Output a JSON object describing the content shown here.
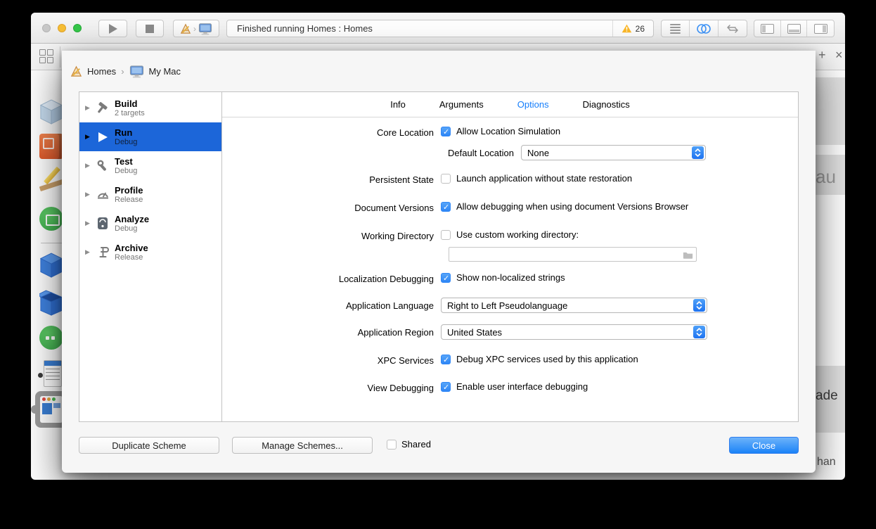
{
  "toolbar": {
    "status_text": "Finished running Homes : Homes",
    "warning_count": "26"
  },
  "window_chrome": {
    "tab_add": "+",
    "tab_close": "×"
  },
  "background": {
    "fragments": [
      "au",
      "ade",
      "han"
    ]
  },
  "sheet": {
    "breadcrumb": {
      "project": "Homes",
      "separator": "›",
      "destination": "My Mac"
    },
    "sidebar": {
      "items": [
        {
          "title": "Build",
          "subtitle": "2 targets",
          "selected": false
        },
        {
          "title": "Run",
          "subtitle": "Debug",
          "selected": true
        },
        {
          "title": "Test",
          "subtitle": "Debug",
          "selected": false
        },
        {
          "title": "Profile",
          "subtitle": "Release",
          "selected": false
        },
        {
          "title": "Analyze",
          "subtitle": "Debug",
          "selected": false
        },
        {
          "title": "Archive",
          "subtitle": "Release",
          "selected": false
        }
      ]
    },
    "tabs": [
      {
        "label": "Info",
        "selected": false
      },
      {
        "label": "Arguments",
        "selected": false
      },
      {
        "label": "Options",
        "selected": true
      },
      {
        "label": "Diagnostics",
        "selected": false
      }
    ],
    "form": {
      "rows": [
        {
          "label": "Core Location",
          "control": "checkbox",
          "checked": true,
          "text": "Allow Location Simulation"
        },
        {
          "label": "Default Location",
          "control": "popup",
          "value": "None"
        },
        {
          "label": "Persistent State",
          "control": "checkbox",
          "checked": false,
          "text": "Launch application without state restoration"
        },
        {
          "label": "Document Versions",
          "control": "checkbox",
          "checked": true,
          "text": "Allow debugging when using document Versions Browser"
        },
        {
          "label": "Working Directory",
          "control": "checkbox-field",
          "checked": false,
          "text": "Use custom working directory:",
          "field_value": ""
        },
        {
          "label": "Localization Debugging",
          "control": "checkbox",
          "checked": true,
          "text": "Show non-localized strings"
        },
        {
          "label": "Application Language",
          "control": "popup",
          "value": "Right to Left Pseudolanguage"
        },
        {
          "label": "Application Region",
          "control": "popup",
          "value": "United States"
        },
        {
          "label": "XPC Services",
          "control": "checkbox",
          "checked": true,
          "text": "Debug XPC services used by this application"
        },
        {
          "label": "View Debugging",
          "control": "checkbox",
          "checked": true,
          "text": "Enable user interface debugging"
        }
      ]
    },
    "footer": {
      "duplicate_label": "Duplicate Scheme",
      "manage_label": "Manage Schemes...",
      "shared_label": "Shared",
      "shared_checked": false,
      "close_label": "Close"
    }
  },
  "icons": {
    "play-icon": "▶",
    "stop-icon": "■",
    "xcode-scheme-icon": "A-frame-pencil",
    "my-mac-icon": "display-monitor",
    "warning-icon": "⚠",
    "standard-editor-icon": "text-lines",
    "assistant-editor-icon": "linked-circles",
    "version-editor-icon": "left-right-arrows",
    "navigator-panel-icon": "left-panel-rect",
    "debug-area-icon": "bottom-panel-rect",
    "inspector-panel-icon": "right-panel-rect",
    "disclosure-icon": "▶",
    "build-icon": "hammer",
    "run-icon": "play-triangle",
    "test-icon": "wrench",
    "profile-icon": "gauge",
    "analyze-icon": "meter-badge",
    "archive-icon": "clamp",
    "popup-stepper-icon": "up-down-chevrons",
    "folder-icon": "folder",
    "check-icon": "✓",
    "grid-icon": "2x2-squares"
  },
  "colors": {
    "selection_blue": "#1c66d9",
    "tab_active_blue": "#157efb",
    "checkbox_blue": "#2e86f6",
    "close_button_blue": "#1b83f7",
    "warning_yellow": "#fcb827"
  }
}
